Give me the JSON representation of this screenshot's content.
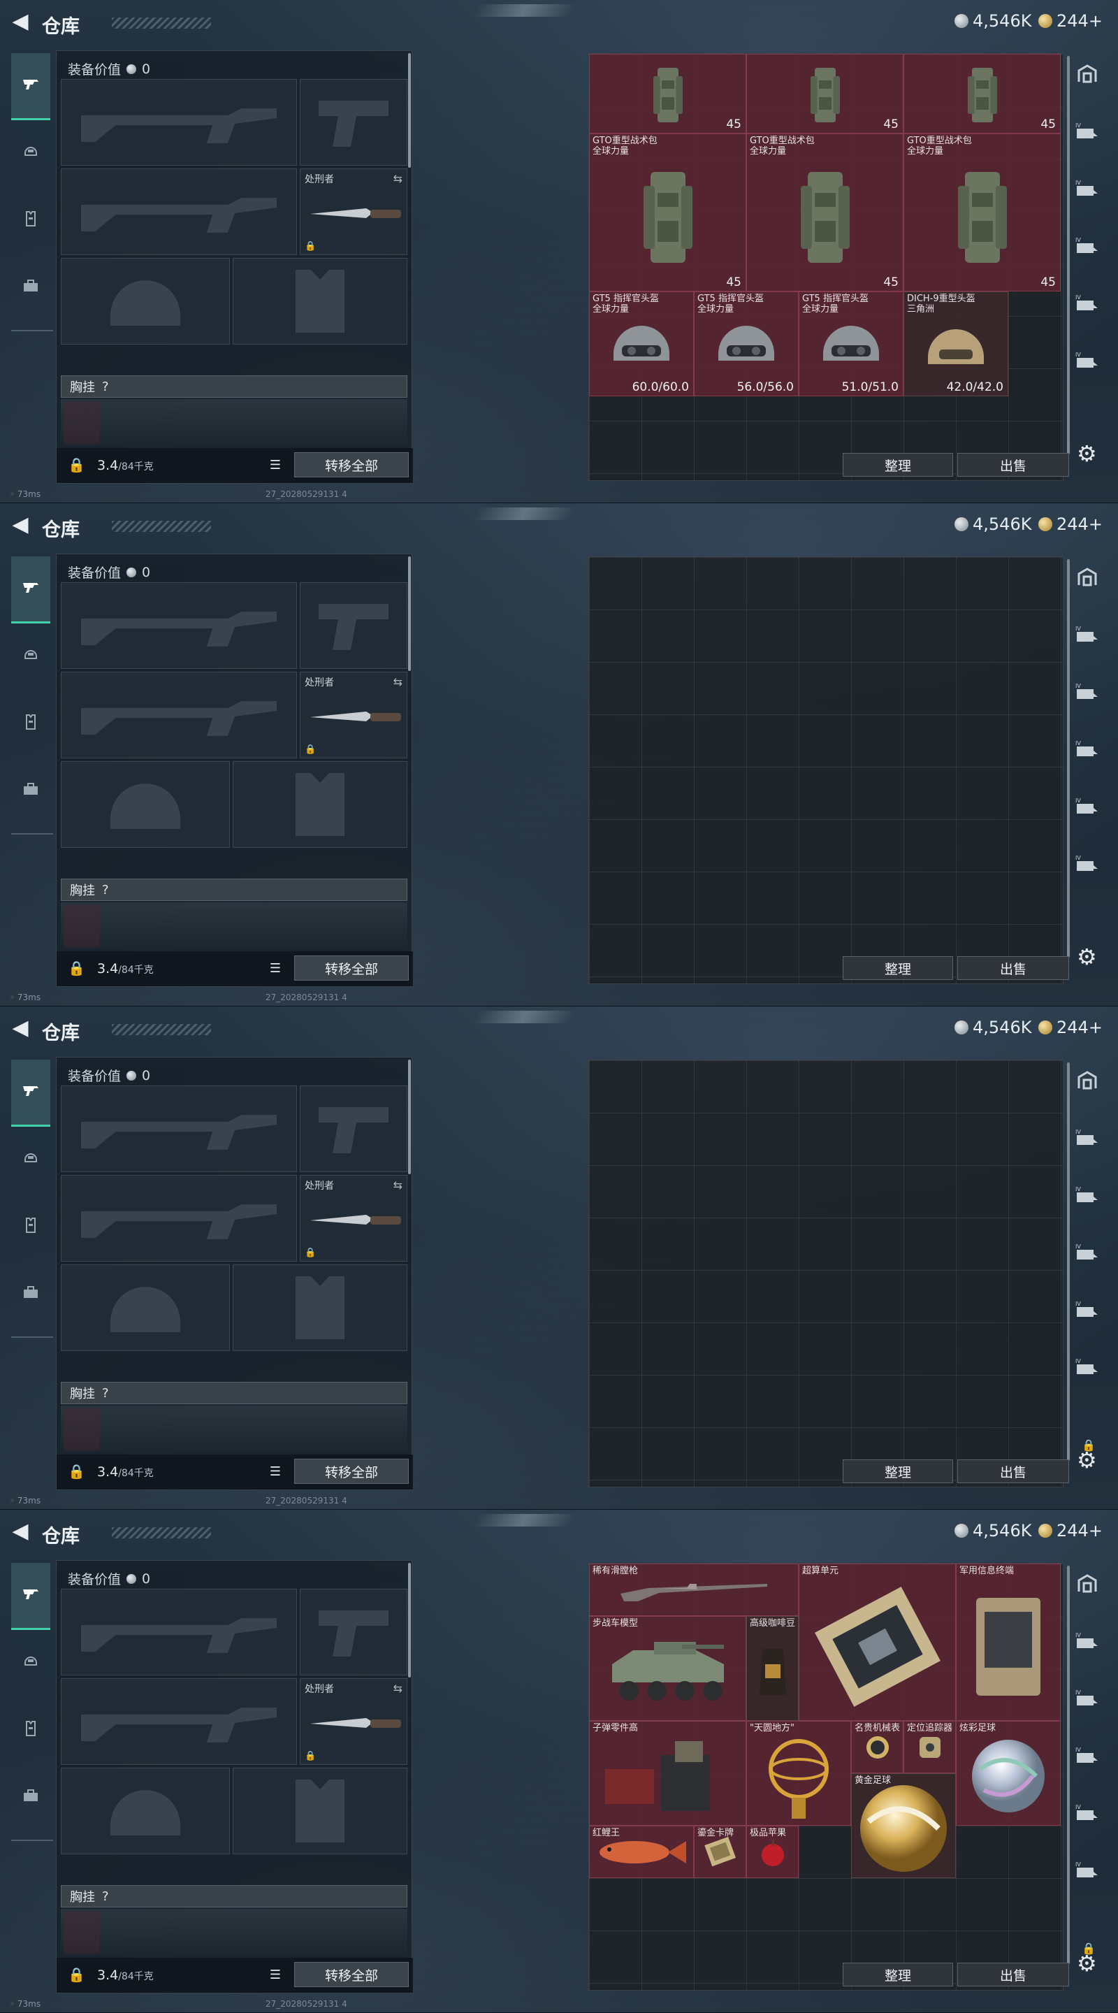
{
  "header": {
    "title": "仓库",
    "currency_silver": "4,546K",
    "currency_gold": "244",
    "add_label": "+"
  },
  "loadout": {
    "equip_value_label": "装备价值",
    "equip_value": "0",
    "melee_name": "处刑者",
    "chest_label": "胸挂",
    "chest_help": "?",
    "weight_current": "3.4",
    "weight_max": "/84千克",
    "transfer_all": "转移全部"
  },
  "storage": {
    "sort_label": "整理",
    "sell_label": "出售"
  },
  "status": {
    "ping": "73ms",
    "build": "27_20280529131 4"
  },
  "screens": [
    {
      "items": [
        {
          "name": "",
          "val": "45",
          "kind": "pack-top"
        },
        {
          "name": "",
          "val": "45",
          "kind": "pack-top"
        },
        {
          "name": "",
          "val": "45",
          "kind": "pack-top"
        },
        {
          "name": "GTO重型战术包\n全球力量",
          "val": "45",
          "kind": "pack"
        },
        {
          "name": "GTO重型战术包\n全球力量",
          "val": "45",
          "kind": "pack"
        },
        {
          "name": "GTO重型战术包\n全球力量",
          "val": "45",
          "kind": "pack"
        },
        {
          "name": "GT5 指挥官头盔\n全球力量",
          "val": "60.0/60.0",
          "kind": "helmet"
        },
        {
          "name": "GT5 指挥官头盔\n全球力量",
          "val": "56.0/56.0",
          "kind": "helmet"
        },
        {
          "name": "GT5 指挥官头盔\n全球力量",
          "val": "51.0/51.0",
          "kind": "helmet"
        },
        {
          "name": "DICH-9重型头盔\n三角洲",
          "val": "42.0/42.0",
          "kind": "helmet-tan"
        }
      ]
    },
    {
      "items": []
    },
    {
      "items": []
    },
    {
      "items": [
        {
          "name": "稀有滑膛枪",
          "val": "",
          "kind": "rifle"
        },
        {
          "name": "超算单元",
          "val": "",
          "kind": "chip"
        },
        {
          "name": "军用信息终端",
          "val": "",
          "kind": "terminal"
        },
        {
          "name": "步战车模型",
          "val": "",
          "kind": "ifv"
        },
        {
          "name": "高级咖啡豆",
          "val": "",
          "kind": "coffee"
        },
        {
          "name": "子弹零件高",
          "val": "",
          "kind": "parts"
        },
        {
          "name": "\"天圆地方\"",
          "val": "",
          "kind": "sphere-gold"
        },
        {
          "name": "名贵机械表",
          "val": "",
          "kind": "watch"
        },
        {
          "name": "定位追踪器",
          "val": "",
          "kind": "tracker"
        },
        {
          "name": "炫彩足球",
          "val": "",
          "kind": "ball-color"
        },
        {
          "name": "黄金足球",
          "val": "",
          "kind": "ball-gold"
        },
        {
          "name": "红鲤王",
          "val": "",
          "kind": "fish"
        },
        {
          "name": "鎏金卡牌",
          "val": "",
          "kind": "card"
        },
        {
          "name": "极品苹果",
          "val": "",
          "kind": "apple"
        }
      ]
    }
  ],
  "colors": {
    "accent": "#40d2a9",
    "item_bg": "#5c2432"
  }
}
